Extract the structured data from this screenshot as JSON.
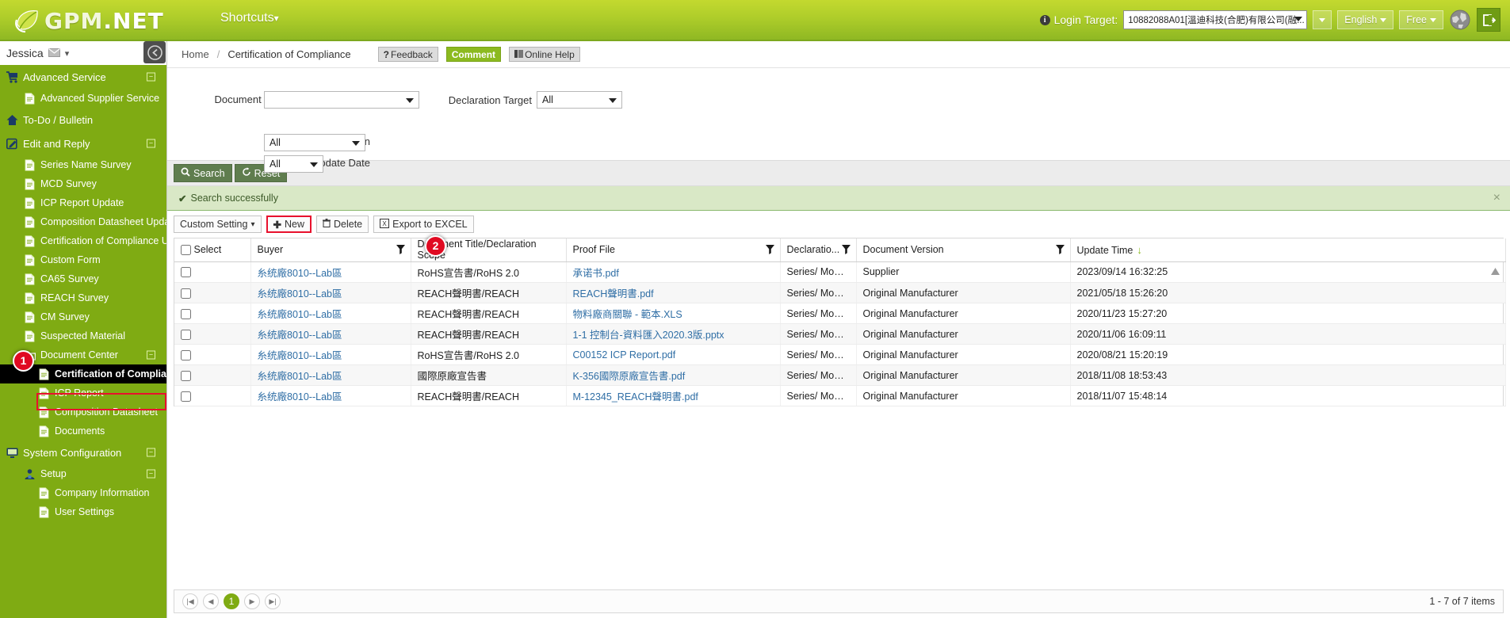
{
  "header": {
    "brand": "GPM.NET",
    "brand_part1": "GPM",
    "brand_part2": ".NET",
    "shortcuts_label": "Shortcuts",
    "login_target_label": "Login Target:",
    "login_target_value": "10882088A01[溫迪科技(合肥)有限公司(融...",
    "language_label": "English",
    "plan_label": "Free"
  },
  "sidebar": {
    "user_name": "Jessica",
    "items": [
      {
        "label": "Advanced Service",
        "level": "group",
        "icon": "cart-icon",
        "collapse": true
      },
      {
        "label": "Advanced Supplier Service",
        "level": "lvl2",
        "icon": "document-icon",
        "collapse": false
      },
      {
        "label": "To-Do / Bulletin",
        "level": "group",
        "icon": "home-icon",
        "collapse": false
      },
      {
        "label": "Edit and Reply",
        "level": "group",
        "icon": "pencil-icon",
        "collapse": true
      },
      {
        "label": "Series Name Survey",
        "level": "lvl2",
        "icon": "document-icon",
        "collapse": false
      },
      {
        "label": "MCD Survey",
        "level": "lvl2",
        "icon": "document-icon",
        "collapse": false
      },
      {
        "label": "ICP Report Update",
        "level": "lvl2",
        "icon": "document-icon",
        "collapse": false
      },
      {
        "label": "Composition Datasheet Update",
        "level": "lvl2",
        "icon": "document-icon",
        "collapse": false
      },
      {
        "label": "Certification of Compliance Update",
        "level": "lvl2",
        "icon": "document-icon",
        "collapse": false
      },
      {
        "label": "Custom Form",
        "level": "lvl2",
        "icon": "document-icon",
        "collapse": false
      },
      {
        "label": "CA65 Survey",
        "level": "lvl2",
        "icon": "document-icon",
        "collapse": false
      },
      {
        "label": "REACH Survey",
        "level": "lvl2",
        "icon": "document-icon",
        "collapse": false
      },
      {
        "label": "CM Survey",
        "level": "lvl2",
        "icon": "document-icon",
        "collapse": false
      },
      {
        "label": "Suspected Material",
        "level": "lvl2",
        "icon": "document-icon",
        "collapse": false
      },
      {
        "label": "Document Center",
        "level": "lvl2",
        "icon": "folder-icon",
        "collapse": true
      },
      {
        "label": "Certification of Compliance",
        "level": "lvl3",
        "icon": "document-icon",
        "collapse": false,
        "selected": true
      },
      {
        "label": "ICP Report",
        "level": "lvl3",
        "icon": "document-icon",
        "collapse": false
      },
      {
        "label": "Composition Datasheet",
        "level": "lvl3",
        "icon": "document-icon",
        "collapse": false
      },
      {
        "label": "Documents",
        "level": "lvl3",
        "icon": "document-icon",
        "collapse": false
      },
      {
        "label": "System Configuration",
        "level": "group",
        "icon": "monitor-icon",
        "collapse": true
      },
      {
        "label": "Setup",
        "level": "lvl2",
        "icon": "setup-icon",
        "collapse": true
      },
      {
        "label": "Company Information",
        "level": "lvl3",
        "icon": "document-icon",
        "collapse": false
      },
      {
        "label": "User Settings",
        "level": "lvl3",
        "icon": "document-icon",
        "collapse": false
      }
    ]
  },
  "breadcrumb": {
    "home": "Home",
    "separator": "/",
    "current": "Certification of Compliance",
    "feedback": "Feedback",
    "comment": "Comment",
    "online_help": "Online Help"
  },
  "search_form": {
    "document_title_label": "Document Title/Declaration Scope",
    "document_title_value": "",
    "declaration_target_label": "Declaration Target",
    "declaration_target_value": "All",
    "document_version_label": "Document Version",
    "document_version_value": "All",
    "update_date_label": "Update Date",
    "update_date_value": "All",
    "search_button": "Search",
    "reset_button": "Reset"
  },
  "alert": {
    "message": "Search successfully"
  },
  "grid_toolbar": {
    "custom_setting": "Custom Setting",
    "new": "New",
    "delete": "Delete",
    "export": "Export to EXCEL"
  },
  "grid": {
    "columns": [
      {
        "label": "Select",
        "filter": false,
        "checkbox": true
      },
      {
        "label": "Buyer",
        "filter": true
      },
      {
        "label": "Document Title/Declaration Scope",
        "filter": false
      },
      {
        "label": "Proof File",
        "filter": true
      },
      {
        "label": "Declaratio...",
        "filter": true
      },
      {
        "label": "Document Version",
        "filter": true
      },
      {
        "label": "Update Time",
        "filter": false,
        "sorted": "desc"
      }
    ],
    "rows": [
      {
        "buyer": "糸统廠8010--Lab區",
        "title": "RoHS宣告書/RoHS 2.0",
        "proof": "承诺书.pdf",
        "declaration": "Series/ Models/...",
        "version": "Supplier",
        "update": "2023/09/14 16:32:25"
      },
      {
        "buyer": "糸统廠8010--Lab區",
        "title": "REACH聲明書/REACH",
        "proof": "REACH聲明書.pdf",
        "declaration": "Series/ Models/...",
        "version": "Original Manufacturer",
        "update": "2021/05/18 15:26:20"
      },
      {
        "buyer": "糸统廠8010--Lab區",
        "title": "REACH聲明書/REACH",
        "proof": "物料廠商關聯 - 範本.XLS",
        "declaration": "Series/ Models/...",
        "version": "Original Manufacturer",
        "update": "2020/11/23 15:27:20"
      },
      {
        "buyer": "糸统廠8010--Lab區",
        "title": "REACH聲明書/REACH",
        "proof": "1-1 控制台-資料匯入2020.3版.pptx",
        "declaration": "Series/ Models/...",
        "version": "Original Manufacturer",
        "update": "2020/11/06 16:09:11"
      },
      {
        "buyer": "糸统廠8010--Lab區",
        "title": "RoHS宣告書/RoHS 2.0",
        "proof": "C00152 ICP Report.pdf",
        "declaration": "Series/ Models/...",
        "version": "Original Manufacturer",
        "update": "2020/08/21 15:20:19"
      },
      {
        "buyer": "糸统廠8010--Lab區",
        "title": "國際原廠宣告書",
        "proof": "K-356國際原廠宣告書.pdf",
        "declaration": "Series/ Models/...",
        "version": "Original Manufacturer",
        "update": "2018/11/08 18:53:43"
      },
      {
        "buyer": "糸统廠8010--Lab區",
        "title": "REACH聲明書/REACH",
        "proof": "M-12345_REACH聲明書.pdf",
        "declaration": "Series/ Models/...",
        "version": "Original Manufacturer",
        "update": "2018/11/07 15:48:14"
      }
    ]
  },
  "pager": {
    "first": "|◀",
    "prev": "◀",
    "current_page": "1",
    "next": "▶",
    "last": "▶|",
    "info": "1 - 7 of 7 items"
  },
  "annotations": [
    {
      "number": "1"
    },
    {
      "number": "2"
    }
  ],
  "colors": {
    "brand_green": "#8fb823",
    "sidebar_green": "#7fab13",
    "accent_red": "#e8112d",
    "link_blue": "#2f6ea5"
  }
}
